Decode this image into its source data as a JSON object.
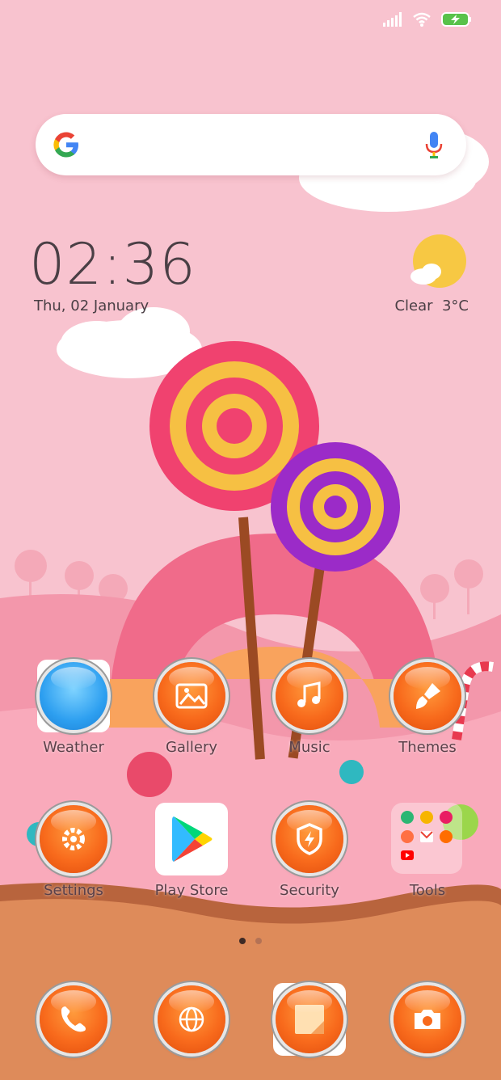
{
  "status_bar": {
    "signal_icon": "signal-icon",
    "wifi_icon": "wifi-icon",
    "battery_icon": "battery-charging-icon"
  },
  "search": {
    "logo": "google-g-icon",
    "mic": "mic-icon"
  },
  "clock": {
    "time": "02:36",
    "date": "Thu, 02 January"
  },
  "weather": {
    "icon": "partly-sunny-icon",
    "text": "Clear  3°C"
  },
  "apps_row1": [
    {
      "label": "Weather",
      "icon": "weather-icon"
    },
    {
      "label": "Gallery",
      "icon": "gallery-icon"
    },
    {
      "label": "Music",
      "icon": "music-icon"
    },
    {
      "label": "Themes",
      "icon": "brush-icon"
    }
  ],
  "apps_row2": [
    {
      "label": "Settings",
      "icon": "gear-icon"
    },
    {
      "label": "Play Store",
      "icon": "play-store-icon"
    },
    {
      "label": "Security",
      "icon": "shield-icon"
    },
    {
      "label": "Tools",
      "icon": "folder-icon"
    }
  ],
  "page_indicator": {
    "pages": 2,
    "current": 1
  },
  "dock": [
    {
      "name": "phone",
      "icon": "phone-icon"
    },
    {
      "name": "browser",
      "icon": "globe-icon"
    },
    {
      "name": "notes",
      "icon": "notes-icon"
    },
    {
      "name": "camera",
      "icon": "camera-icon"
    }
  ],
  "colors": {
    "background": "#f8c3cf",
    "accent": "#f86a1c",
    "text": "#4a3f45"
  }
}
